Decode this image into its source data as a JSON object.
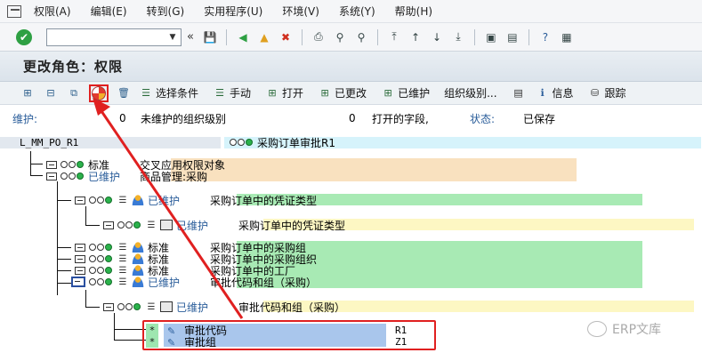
{
  "menu": {
    "items": [
      "权限(A)",
      "编辑(E)",
      "转到(G)",
      "实用程序(U)",
      "环境(V)",
      "系统(Y)",
      "帮助(H)"
    ]
  },
  "title": "更改角色：权限",
  "appbar": {
    "select_criteria": "选择条件",
    "manual": "手动",
    "open": "打开",
    "changed": "已更改",
    "maintained": "已维护",
    "org_levels": "组织级别...",
    "info": "信息",
    "trace": "跟踪"
  },
  "status": {
    "maintain_label": "维护:",
    "unmaintained_count": "0",
    "unmaintained_text": "未维护的组织级别",
    "open_count": "0",
    "open_text": "打开的字段,",
    "state_label": "状态:",
    "state_value": "已保存"
  },
  "tree": {
    "root_name": "L_MM_PO_R1",
    "root_desc": "采购订单审批R1",
    "n1_status": "标准",
    "n1_desc": "交叉应用权限对象",
    "n2_status": "已维护",
    "n2_desc": "商品管理:采购",
    "n3_status": "已维护",
    "n3_desc": "采购订单中的凭证类型",
    "n4_status": "已维护",
    "n4_desc": "采购订单中的凭证类型",
    "n5_status": "标准",
    "n5_desc": "采购订单中的采购组",
    "n6_status": "标准",
    "n6_desc": "采购订单中的采购组织",
    "n7_status": "标准",
    "n7_desc": "采购订单中的工厂",
    "n8_status": "已维护",
    "n8_desc": "审批代码和组（采购）",
    "n9_status": "已维护",
    "n9_desc": "审批代码和组（采购）",
    "f1_name": "审批代码",
    "f1_value": "R1",
    "f2_name": "审批组",
    "f2_value": "Z1"
  },
  "watermark": "ERP文库",
  "colors": {
    "highlight_red": "#e02020",
    "green_band": "#a8eab4",
    "yellow_band": "#fdf7c3",
    "orange_band": "#f9e1bf",
    "blue_field": "#a9c6ec"
  }
}
